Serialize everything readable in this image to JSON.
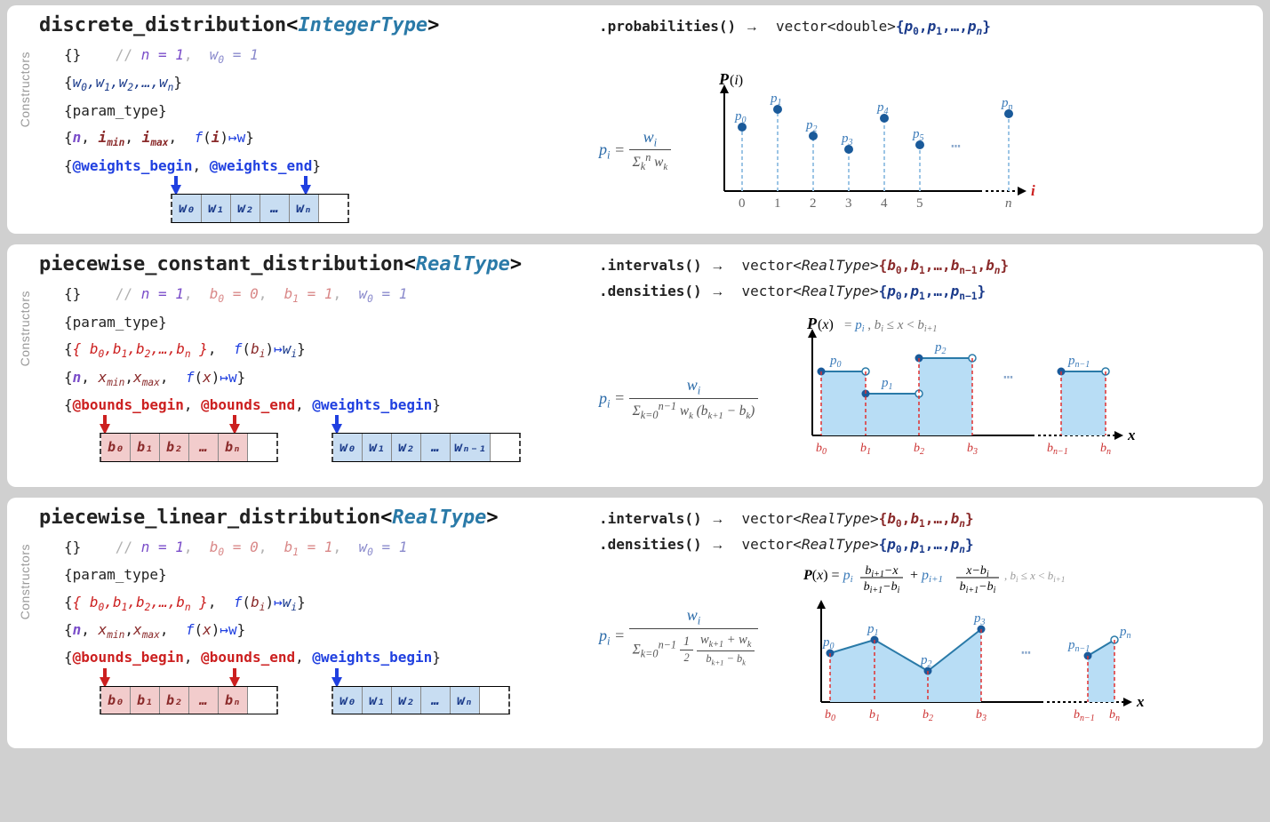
{
  "cards": [
    {
      "title_main": "discrete_distribution",
      "title_template": "IntegerType",
      "constructors_label": "Constructors",
      "ctor_empty_comment": "// n = 1,  w₀ = 1",
      "ctor_weights_list": "{w₀,w₁,w₂,…,wₙ}",
      "ctor_param": "{param_type}",
      "ctor_func": "n, iₘᵢₙ, iₘₐₓ,  f(i)↦w",
      "ctor_iter_begin": "@weights_begin",
      "ctor_iter_end": "@weights_end",
      "array_cells": [
        "w₀",
        "w₁",
        "w₂",
        "…",
        "wₙ",
        ""
      ],
      "method_probabilities": ".probabilities()",
      "method_arrow": "→",
      "method_ret_prefix": "vector<double>",
      "method_ret_items": "{p₀,p₁,…,pₙ}",
      "formula_lhs": "pᵢ =",
      "formula_num": "wᵢ",
      "formula_den": "Σₖⁿ wₖ",
      "chart_data": {
        "type": "lollipop",
        "title": "P(i)",
        "xlabel": "i",
        "x_ticks": [
          "0",
          "1",
          "2",
          "3",
          "4",
          "5",
          "…",
          "n"
        ],
        "point_labels": [
          "p₀",
          "p₁",
          "p₂",
          "p₃",
          "p₄",
          "p₅",
          "pₙ"
        ],
        "values": [
          0.7,
          0.9,
          0.6,
          0.45,
          0.8,
          0.5,
          0.85
        ]
      }
    },
    {
      "title_main": "piecewise_constant_distribution",
      "title_template": "RealType",
      "constructors_label": "Constructors",
      "ctor_empty_comment": "// n = 1,  b₀ = 0,  b₁ = 1,  w₀ = 1",
      "ctor_param": "{param_type}",
      "ctor_bounds_list": "{b₀,b₁,b₂,…,bₙ}",
      "ctor_func_fb": "f(bᵢ)↦wᵢ",
      "ctor_nxx": "n, xₘᵢₙ,xₘₐₓ,  f(x)↦w",
      "ctor_iter_b_begin": "@bounds_begin",
      "ctor_iter_b_end": "@bounds_end",
      "ctor_iter_w_begin": "@weights_begin",
      "array_b": [
        "b₀",
        "b₁",
        "b₂",
        "…",
        "bₙ",
        ""
      ],
      "array_w": [
        "w₀",
        "w₁",
        "w₂",
        "…",
        "wₙ₋₁",
        ""
      ],
      "method_intervals": ".intervals()",
      "method_densities": ".densities()",
      "method_arrow": "→",
      "method_ret_type": "vector<RealType>",
      "method_ret_b": "{b₀,b₁,…,bₙ₋₁,bₙ}",
      "method_ret_p": "{p₀,p₁,…,pₙ₋₁}",
      "formula_lhs": "pᵢ =",
      "formula_num": "wᵢ",
      "formula_den": "Σₖ₌₀ⁿ⁻¹ wₖ (bₖ₊₁ − bₖ)",
      "chart_data": {
        "type": "step",
        "title": "P(x)",
        "title_rhs": "= pᵢ , bᵢ ≤ x < bᵢ₊₁",
        "xlabel": "x",
        "x_breaks_labels": [
          "b₀",
          "b₁",
          "b₂",
          "b₃",
          "…",
          "bₙ₋₁",
          "bₙ"
        ],
        "step_labels": [
          "p₀",
          "p₁",
          "p₂",
          "pₙ₋₁"
        ],
        "step_values": [
          0.7,
          0.45,
          0.85,
          0.7
        ]
      }
    },
    {
      "title_main": "piecewise_linear_distribution",
      "title_template": "RealType",
      "constructors_label": "Constructors",
      "ctor_empty_comment": "// n = 1,  b₀ = 0,  b₁ = 1,  w₀ = 1",
      "ctor_param": "{param_type}",
      "ctor_bounds_list": "{b₀,b₁,b₂,…,bₙ}",
      "ctor_func_fb": "f(bᵢ)↦wᵢ",
      "ctor_nxx": "n, xₘᵢₙ,xₘₐₓ,  f(x)↦w",
      "ctor_iter_b_begin": "@bounds_begin",
      "ctor_iter_b_end": "@bounds_end",
      "ctor_iter_w_begin": "@weights_begin",
      "array_b": [
        "b₀",
        "b₁",
        "b₂",
        "…",
        "bₙ",
        ""
      ],
      "array_w": [
        "w₀",
        "w₁",
        "w₂",
        "…",
        "wₙ",
        ""
      ],
      "method_intervals": ".intervals()",
      "method_densities": ".densities()",
      "method_arrow": "→",
      "method_ret_type": "vector<RealType>",
      "method_ret_b": "{b₀,b₁,…,bₙ}",
      "method_ret_p": "{p₀,p₁,…,pₙ}",
      "formula_lhs": "pᵢ =",
      "formula_num": "wᵢ",
      "formula_den_outer": "Σₖ₌₀ⁿ⁻¹ ½ (wₖ₊₁ + wₖ)/(bₖ₊₁ − bₖ)",
      "px_formula": "P(x) = pᵢ (bᵢ₊₁−x)/(bᵢ₊₁−bᵢ) + pᵢ₊₁ (x−bᵢ)/(bᵢ₊₁−bᵢ) , bᵢ ≤ x < bᵢ₊₁",
      "chart_data": {
        "type": "line-area",
        "xlabel": "x",
        "x_breaks_labels": [
          "b₀",
          "b₁",
          "b₂",
          "b₃",
          "…",
          "bₙ₋₁",
          "bₙ"
        ],
        "point_labels": [
          "p₀",
          "p₁",
          "p₂",
          "p₃",
          "pₙ₋₁",
          "pₙ"
        ],
        "values": [
          0.55,
          0.7,
          0.35,
          0.8,
          0.5,
          0.7
        ]
      }
    }
  ]
}
